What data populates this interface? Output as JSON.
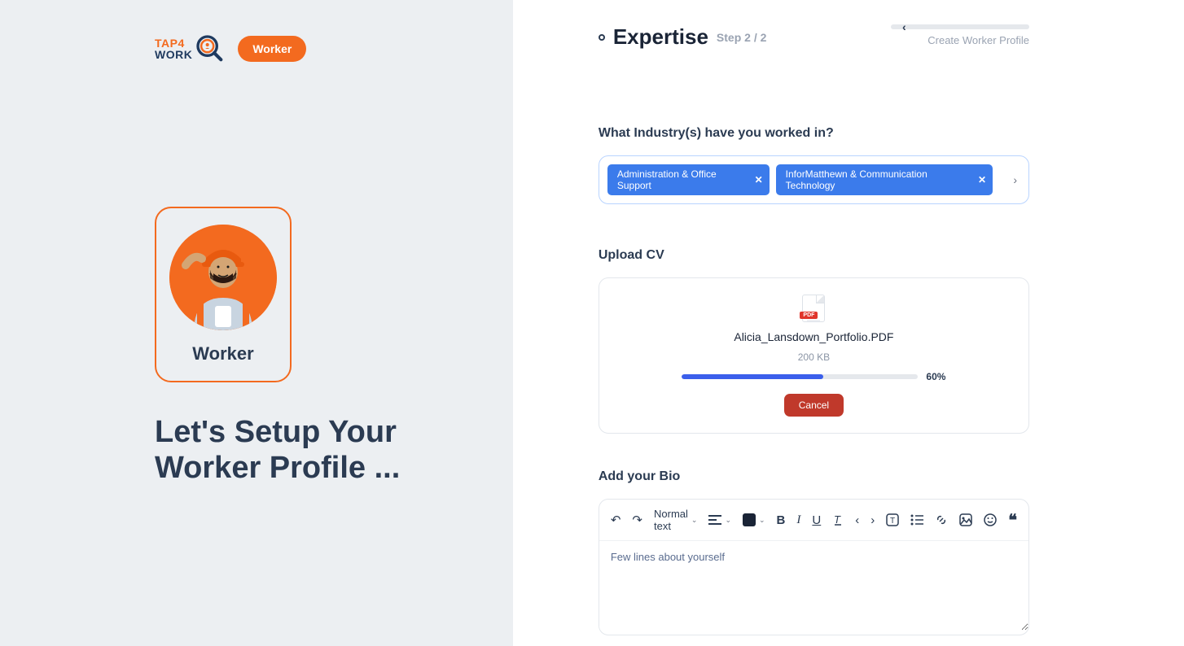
{
  "logo": {
    "tap4": "TAP4",
    "work": "WORK"
  },
  "worker_badge": "Worker",
  "worker_card_label": "Worker",
  "headline": "Let's Setup Your Worker Profile ...",
  "header": {
    "title": "Expertise",
    "step": "Step 2 / 2",
    "create_label": "Create Worker Profile"
  },
  "industry": {
    "title": "What Industry(s) have you worked in?",
    "chips": [
      "Administration & Office Support",
      "InforMatthewn & Communication Technology"
    ]
  },
  "upload": {
    "title": "Upload CV",
    "pdf_label": "PDF",
    "filename": "Alicia_Lansdown_Portfolio.PDF",
    "filesize": "200 KB",
    "percent": 60,
    "percent_label": "60%",
    "cancel": "Cancel"
  },
  "bio": {
    "title": "Add your Bio",
    "placeholder": "Few lines about yourself",
    "format_label": "Normal text"
  }
}
